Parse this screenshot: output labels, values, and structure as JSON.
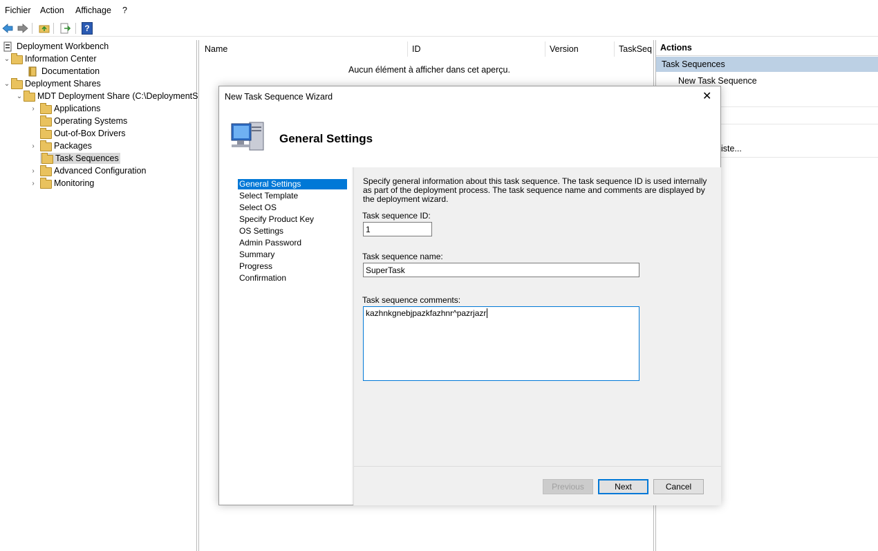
{
  "menu": [
    "Fichier",
    "Action",
    "Affichage",
    "?"
  ],
  "toolbar": {
    "icons": [
      "back-arrow-icon",
      "forward-arrow-icon",
      "up-folder-icon",
      "export-list-icon",
      "help-icon"
    ],
    "help_glyph": "?"
  },
  "tree": {
    "root": "Deployment Workbench",
    "information_center": "Information Center",
    "documentation": "Documentation",
    "deployment_shares": "Deployment Shares",
    "share": "MDT Deployment Share (C:\\DeploymentSh",
    "children": [
      "Applications",
      "Operating Systems",
      "Out-of-Box Drivers",
      "Packages",
      "Task Sequences",
      "Advanced Configuration",
      "Monitoring"
    ]
  },
  "list": {
    "columns": [
      "Name",
      "ID",
      "Version",
      "TaskSequ"
    ],
    "empty_message": "Aucun élément à afficher dans cet aperçu."
  },
  "actions": {
    "header": "Actions",
    "section": "Task Sequences",
    "item_new": "New Task Sequence",
    "item_partial": "iste..."
  },
  "dialog": {
    "title": "New Task Sequence Wizard",
    "close_glyph": "✕",
    "page_heading": "General Settings",
    "nav": [
      "General Settings",
      "Select Template",
      "Select OS",
      "Specify Product Key",
      "OS Settings",
      "Admin Password",
      "Summary",
      "Progress",
      "Confirmation"
    ],
    "description": "Specify general information about this task sequence.  The task sequence ID is used internally as part of the deployment process.  The task sequence name and comments are displayed by the deployment wizard.",
    "id_label": "Task sequence ID:",
    "id_value": "1",
    "name_label": "Task sequence name:",
    "name_value": "SuperTask",
    "comments_label": "Task sequence comments:",
    "comments_value": "kazhnkgnebjpazkfazhnr^pazrjazr",
    "buttons": {
      "previous": "Previous",
      "next": "Next",
      "cancel": "Cancel"
    }
  },
  "colors": {
    "accent": "#0078d7",
    "actions_section_bg": "#bcd0e4",
    "folder": "#e9c25e"
  }
}
